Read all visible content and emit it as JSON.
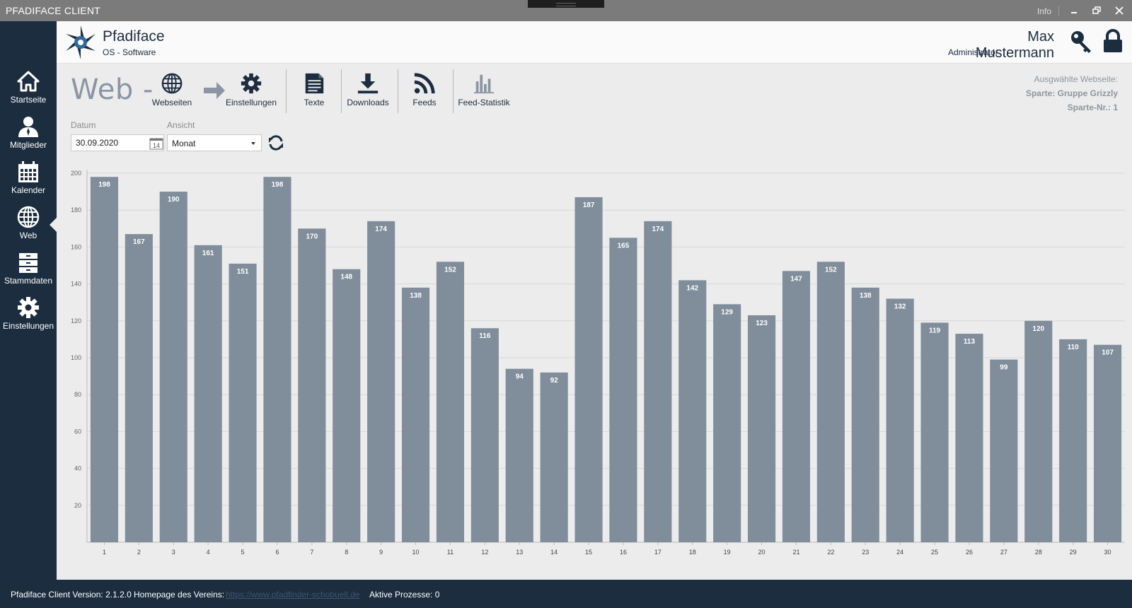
{
  "window": {
    "title": "PFADIFACE CLIENT",
    "info_label": "Info"
  },
  "sidebar": {
    "items": [
      {
        "label": "Startseite",
        "icon": "home-icon"
      },
      {
        "label": "Mitglieder",
        "icon": "user-icon"
      },
      {
        "label": "Kalender",
        "icon": "calendar-icon"
      },
      {
        "label": "Web",
        "icon": "globe-icon",
        "active": true
      },
      {
        "label": "Stammdaten",
        "icon": "archive-icon"
      },
      {
        "label": "Einstellungen",
        "icon": "gear-icon"
      }
    ]
  },
  "header": {
    "brand_name": "Pfadiface",
    "brand_sub": "OS - Software",
    "user_name": "Max Mustermann",
    "user_role": "Administrator"
  },
  "module": {
    "title": "Web -",
    "tools": {
      "webseiten": "Webseiten",
      "einstellungen": "Einstellungen",
      "texte": "Texte",
      "downloads": "Downloads",
      "feeds": "Feeds",
      "feed_statistik": "Feed-Statistik"
    }
  },
  "selected_site": {
    "heading": "Ausgwählte Webseite:",
    "sparte": "Sparte: Gruppe Grizzly",
    "sparte_nr": "Sparte-Nr.: 1"
  },
  "filters": {
    "date_label": "Datum",
    "date_value": "30.09.2020",
    "calendar_day": "14",
    "view_label": "Ansicht",
    "view_value": "Monat"
  },
  "chart_data": {
    "type": "bar",
    "categories": [
      "1",
      "2",
      "3",
      "4",
      "5",
      "6",
      "7",
      "8",
      "9",
      "10",
      "11",
      "12",
      "13",
      "14",
      "15",
      "16",
      "17",
      "18",
      "19",
      "20",
      "21",
      "22",
      "23",
      "24",
      "25",
      "26",
      "27",
      "28",
      "29",
      "30"
    ],
    "values": [
      198,
      167,
      190,
      161,
      151,
      198,
      170,
      148,
      174,
      138,
      152,
      116,
      94,
      92,
      187,
      165,
      174,
      142,
      129,
      123,
      147,
      152,
      138,
      132,
      119,
      113,
      99,
      120,
      110,
      107
    ],
    "yticks": [
      20,
      40,
      60,
      80,
      100,
      120,
      140,
      160,
      180,
      200
    ],
    "ylim": [
      0,
      200
    ],
    "grid": true,
    "bar_color": "#808d9a"
  },
  "footer": {
    "version": "Pfadiface Client Version: 2.1.2.0",
    "homepage_label": "Homepage des Vereins:",
    "homepage_url": "https://www.pfadfinder-schobuell.de",
    "processes": "Aktive Prozesse: 0"
  },
  "colors": {
    "sidebar": "#1c2d40",
    "content_bg": "#ececec",
    "accent": "#1c2d40",
    "title_gray": "#8a96a3"
  }
}
